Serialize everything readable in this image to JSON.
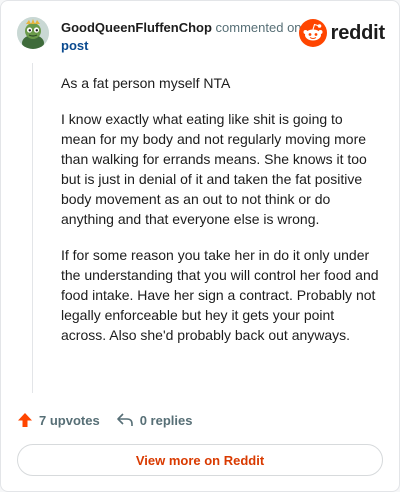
{
  "comment": {
    "username": "GoodQueenFluffenChop",
    "action_text": "commented on",
    "post_link": "post",
    "paragraphs": [
      "As a fat person myself NTA",
      "I know exactly what eating like shit is going to mean for my body and not regularly moving more than walking for errands means. She knows it too but is just in denial of it and taken the fat positive body movement as an out to not think or do anything and that everyone else is wrong.",
      "If for some reason you take her in do it only under the understanding that you will control her food and food intake. Have her sign a contract. Probably not legally enforceable but hey it gets your point across. Also she'd probably back out anyways."
    ],
    "upvotes_label": "7 upvotes",
    "replies_label": "0 replies",
    "view_more_label": "View more on Reddit"
  },
  "branding": {
    "logo_text": "reddit",
    "logo_icon": "reddit-snoo-icon",
    "accent_color": "#ff4500",
    "link_color": "#d93a00"
  },
  "icons": {
    "avatar": "avatar-icon",
    "upvote": "upvote-arrow-icon",
    "reply": "reply-arrow-icon"
  }
}
